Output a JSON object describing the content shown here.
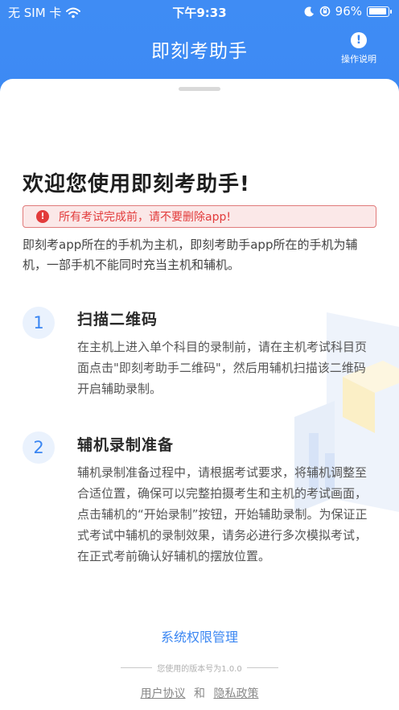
{
  "status_bar": {
    "carrier": "无 SIM 卡",
    "time": "下午9:33",
    "battery": "96%",
    "battery_level": 0.96
  },
  "nav": {
    "title": "即刻考助手",
    "help_icon": "!",
    "help_label": "操作说明"
  },
  "welcome": {
    "heading": "欢迎您使用即刻考助手!",
    "warning_icon": "!",
    "warning": "所有考试完成前，请不要删除app!",
    "intro": "即刻考app所在的手机为主机，即刻考助手app所在的手机为辅机，一部手机不能同时充当主机和辅机。"
  },
  "steps": [
    {
      "number": "1",
      "title": "扫描二维码",
      "description": "在主机上进入单个科目的录制前，请在主机考试科目页面点击\"即刻考助手二维码\"，然后用辅机扫描该二维码开启辅助录制。"
    },
    {
      "number": "2",
      "title": "辅机录制准备",
      "description": "辅机录制准备过程中，请根据考试要求，将辅机调整至合适位置，确保可以完整拍摄考生和主机的考试画面，点击辅机的“开始录制”按钮，开始辅助录制。为保证正式考试中辅机的录制效果，请务必进行多次模拟考试，在正式考前确认好辅机的摆放位置。"
    }
  ],
  "footer": {
    "permissions_link": "系统权限管理",
    "version": "您使用的版本号为1.0.0",
    "user_agreement": "用户协议",
    "and": "和",
    "privacy_policy": "隐私政策"
  },
  "colors": {
    "primary": "#3a86f2",
    "warning": "#e23b3b",
    "warning_bg": "#fbe8e8"
  }
}
